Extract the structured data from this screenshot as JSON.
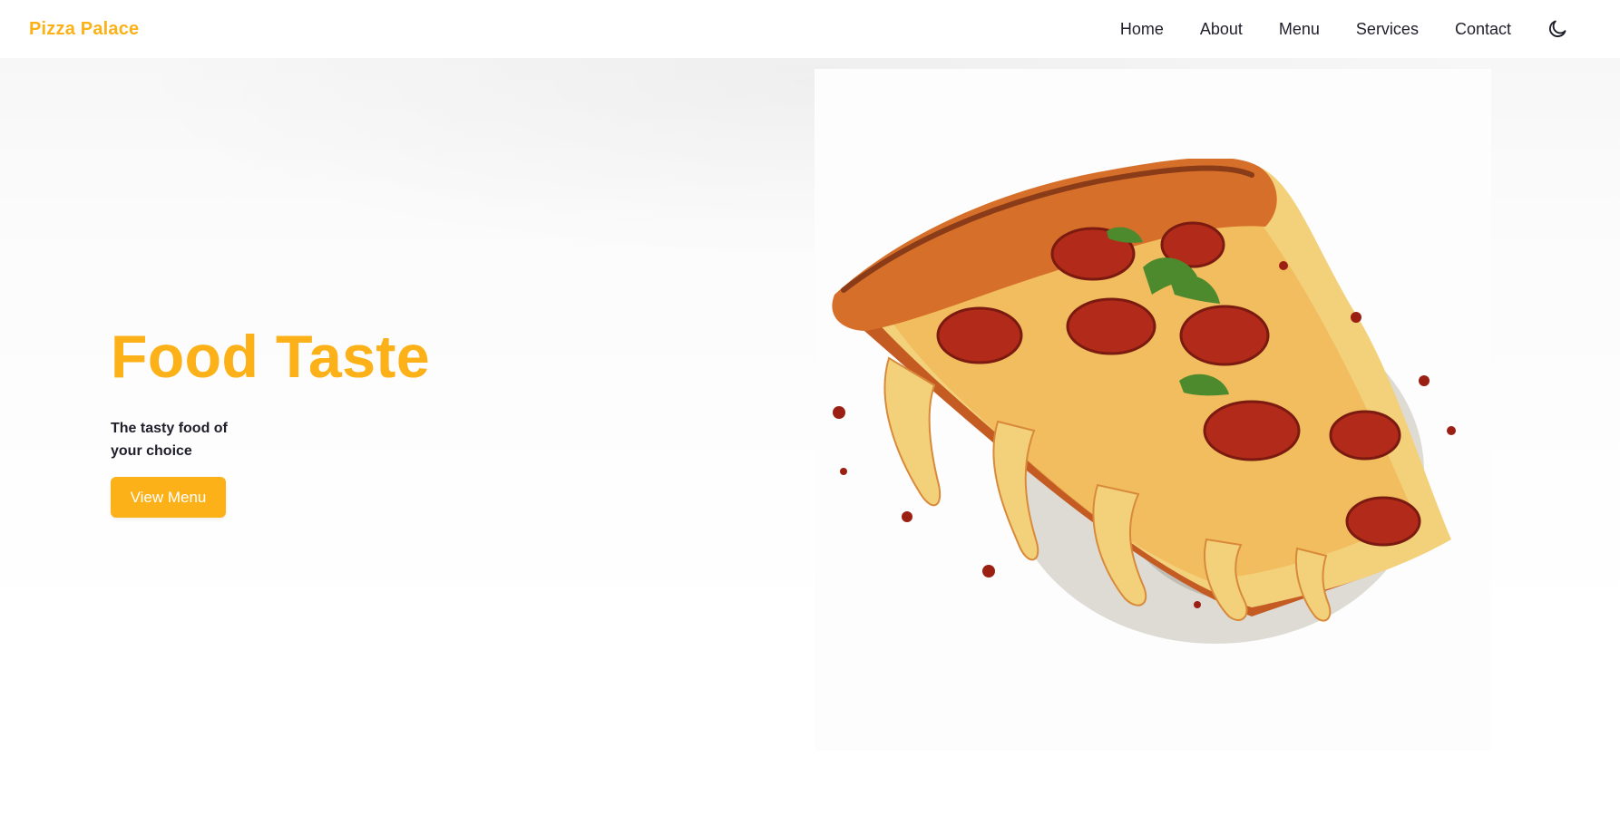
{
  "header": {
    "brand": "Pizza Palace",
    "nav": [
      "Home",
      "About",
      "Menu",
      "Services",
      "Contact"
    ],
    "theme_toggle_icon": "moon-icon"
  },
  "hero": {
    "title": "Food Taste",
    "subtitle": "The tasty food of your choice",
    "cta_label": "View Menu",
    "image_icon": "pizza-slice-illustration"
  },
  "colors": {
    "accent": "#fbb117",
    "text": "#1f1f2b",
    "background": "#ffffff"
  }
}
